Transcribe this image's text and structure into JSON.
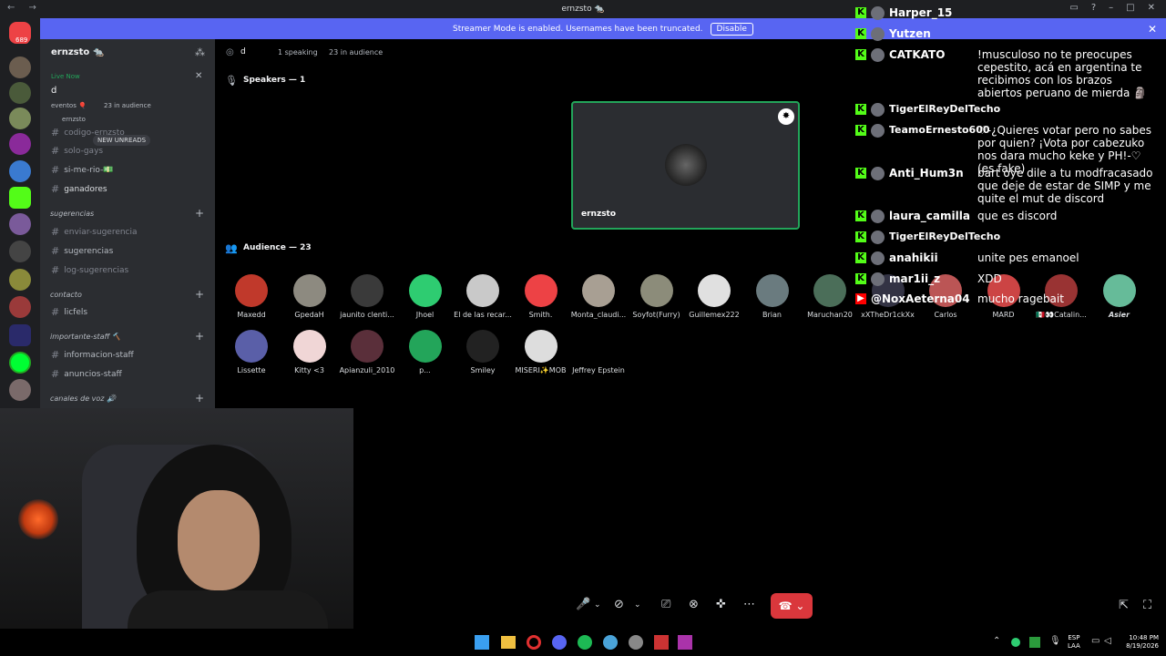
{
  "window": {
    "title": "ernzsto 🐀",
    "nav": "← →"
  },
  "banner": {
    "text": "Streamer Mode is enabled. Usernames have been truncated.",
    "disable": "Disable",
    "close": "✕"
  },
  "rail": {
    "badge": "689"
  },
  "server": {
    "name": "ernzsto 🐀"
  },
  "live": {
    "label": "Live Now",
    "stage_name": "d",
    "event": "eventos 🎈",
    "audience": "23 in audience",
    "host": "ernzsto"
  },
  "channels": [
    {
      "name": "codigo-ernzsto"
    },
    {
      "name": "solo-gays"
    },
    {
      "name": "si-me-rio-💵"
    },
    {
      "name": "ganadores"
    }
  ],
  "new_unreads": "NEW UNREADS",
  "categories": {
    "sugerencias": "sugerencias",
    "contacto": "contacto",
    "staff": "importante-staff 🔨",
    "voz": "canales de voz 🔊"
  },
  "sug_channels": [
    {
      "name": "enviar-sugerencia"
    },
    {
      "name": "sugerencias"
    },
    {
      "name": "log-sugerencias"
    }
  ],
  "contact_channels": [
    {
      "name": "licfels"
    }
  ],
  "staff_channels": [
    {
      "name": "informacion-staff"
    },
    {
      "name": "anuncios-staff"
    }
  ],
  "stage": {
    "title": "d",
    "speaking": "1 speaking",
    "audience": "23 in audience",
    "speakers_header": "Speakers — 1",
    "audience_header": "Audience — 23",
    "speaker_name": "ernzsto"
  },
  "audience": [
    {
      "name": "Maxedd",
      "color": "#c0392b"
    },
    {
      "name": "GpedaH",
      "color": "#8d8a80"
    },
    {
      "name": "jaunito clenti...",
      "color": "#3a3a3a"
    },
    {
      "name": "Jhoel",
      "color": "#2ecc71"
    },
    {
      "name": "El de las recar...",
      "color": "#c9c9c9"
    },
    {
      "name": "Smith.",
      "color": "#ed4245"
    },
    {
      "name": "Monta_claudi...",
      "color": "#a89f93"
    },
    {
      "name": "Soyfot(Furry)",
      "color": "#8c8c7a"
    },
    {
      "name": "Guillemex222",
      "color": "#e0e0e0"
    },
    {
      "name": "Brian",
      "color": "#6a7b7f"
    },
    {
      "name": "Maruchan20",
      "color": "#4b6e59"
    },
    {
      "name": "xXTheDr1ckXx",
      "color": "#334"
    },
    {
      "name": "Carlos",
      "color": "#b55"
    },
    {
      "name": "MARD",
      "color": "#c44"
    },
    {
      "name": "🇲🇽👀Catalin...",
      "color": "#933"
    },
    {
      "name": "𝘼𝙨𝙞𝙚𝙧",
      "color": "#6b9"
    },
    {
      "name": "Lissette",
      "color": "#5a5fa8"
    },
    {
      "name": "Kitty <3",
      "color": "#f0d6d6"
    },
    {
      "name": "Apianzuli_2010",
      "color": "#5a2f3a"
    },
    {
      "name": "p...",
      "color": "#23a55a"
    },
    {
      "name": "Smiley",
      "color": "#222"
    },
    {
      "name": "MISERI✨MOB",
      "color": "#ddd"
    },
    {
      "name": "Jeffrey Epstein",
      "color": "#000"
    }
  ],
  "chat": [
    {
      "user": "Harper_15",
      "text": ""
    },
    {
      "user": "Yutzen",
      "text": ""
    },
    {
      "user": "CATKATO",
      "text": "!musculoso no te preocupes cepestito, acá en argentina te recibimos con los brazos abiertos peruano de mierda 🗿"
    },
    {
      "user": "TigerElReyDelTecho",
      "text": ""
    },
    {
      "user": "TeamoErnesto600",
      "text": "♡-¿Quieres votar pero no sabes por quien? ¡Vota por cabezuko nos dara mucho keke y PH!-♡ (es fake)"
    },
    {
      "user": "Anti_Hum3n",
      "text": "bart oye dile a tu modfracasado que deje de estar de SIMP y me quite el mut de discord"
    },
    {
      "user": "laura_camilla",
      "text": "que es discord"
    },
    {
      "user": "TigerElReyDelTecho",
      "text": ""
    },
    {
      "user": "anahikii",
      "text": "unite pes emanoel"
    },
    {
      "user": "mar1ii_z",
      "text": "XDD"
    },
    {
      "user": "@NoxAeterna04",
      "text": "mucho ragebait"
    }
  ],
  "taskbar": {
    "lang": "ESP",
    "lang2": "LAA",
    "time": "10:48 PM",
    "date": "8/19/2026"
  }
}
